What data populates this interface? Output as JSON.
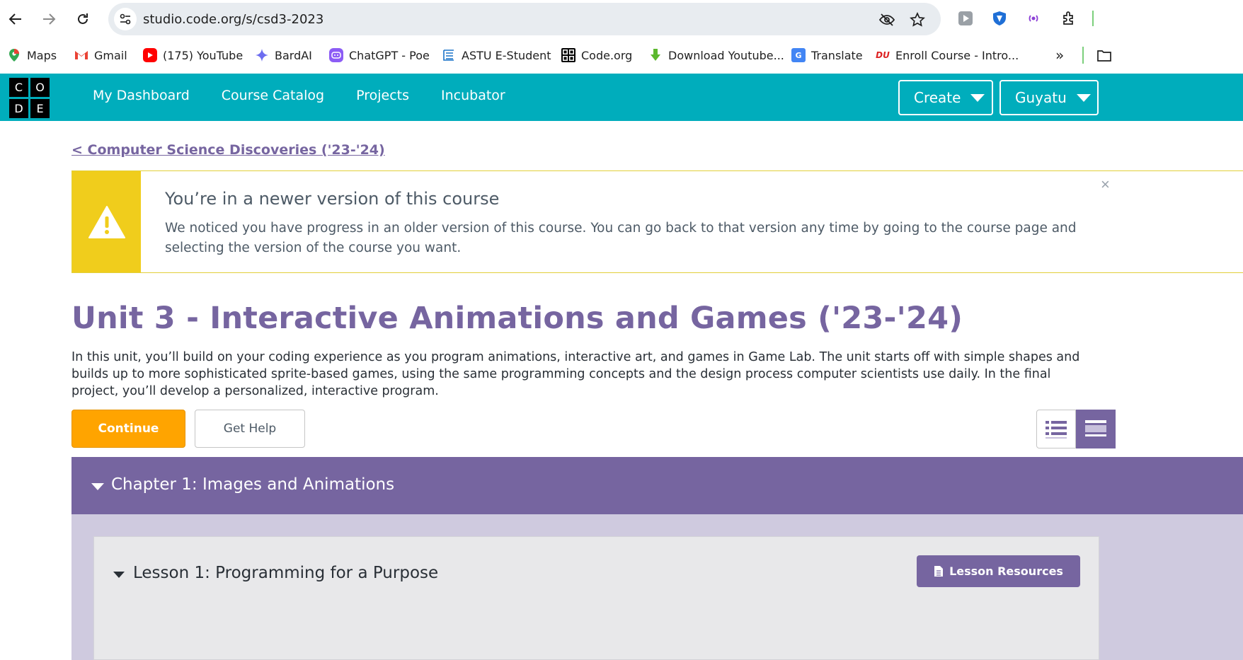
{
  "browser": {
    "url": "studio.code.org/s/csd3-2023",
    "bookmarks": [
      {
        "label": "Maps",
        "icon": "maps-icon"
      },
      {
        "label": "Gmail",
        "icon": "gmail-icon"
      },
      {
        "label": "(175) YouTube",
        "icon": "youtube-icon"
      },
      {
        "label": "BardAI",
        "icon": "bard-icon"
      },
      {
        "label": "ChatGPT - Poe",
        "icon": "poe-icon"
      },
      {
        "label": "ASTU E-Student",
        "icon": "astu-icon"
      },
      {
        "label": "Code.org",
        "icon": "codeorg-icon"
      },
      {
        "label": "Download Youtube...",
        "icon": "download-icon"
      },
      {
        "label": "Translate",
        "icon": "translate-icon"
      },
      {
        "label": "Enroll Course - Intro...",
        "icon": "enroll-icon"
      }
    ],
    "more_bookmarks": "»"
  },
  "header": {
    "logo_letters": [
      "C",
      "O",
      "D",
      "E"
    ],
    "nav": [
      "My Dashboard",
      "Course Catalog",
      "Projects",
      "Incubator"
    ],
    "create_label": "Create",
    "user_label": "Guyatu",
    "accent": "#00adbc"
  },
  "content": {
    "back_link": "< Computer Science Discoveries ('23-'24)",
    "notice": {
      "title": "You’re in a newer version of this course",
      "text": "We noticed you have progress in an older version of this course. You can go back to that version any time by going to the course page and selecting the version of the course you want.",
      "close": "×"
    },
    "unit_title": "Unit 3 - Interactive Animations and Games ('23-'24)",
    "unit_description": "In this unit, you’ll build on your coding experience as you program animations, interactive art, and games in Game Lab. The unit starts off with simple shapes and builds up to more sophisticated sprite-based games, using the same programming concepts and the design process computer scientists use daily. In the final project, you’ll develop a personalized, interactive program.",
    "continue_label": "Continue",
    "help_label": "Get Help",
    "chapter_title": "Chapter 1: Images and Animations",
    "lesson_title": "Lesson 1: Programming for a Purpose",
    "lesson_resources_label": "Lesson Resources"
  },
  "colors": {
    "purple": "#7665a0",
    "orange": "#ffa400",
    "warning": "#f0cd1c"
  }
}
